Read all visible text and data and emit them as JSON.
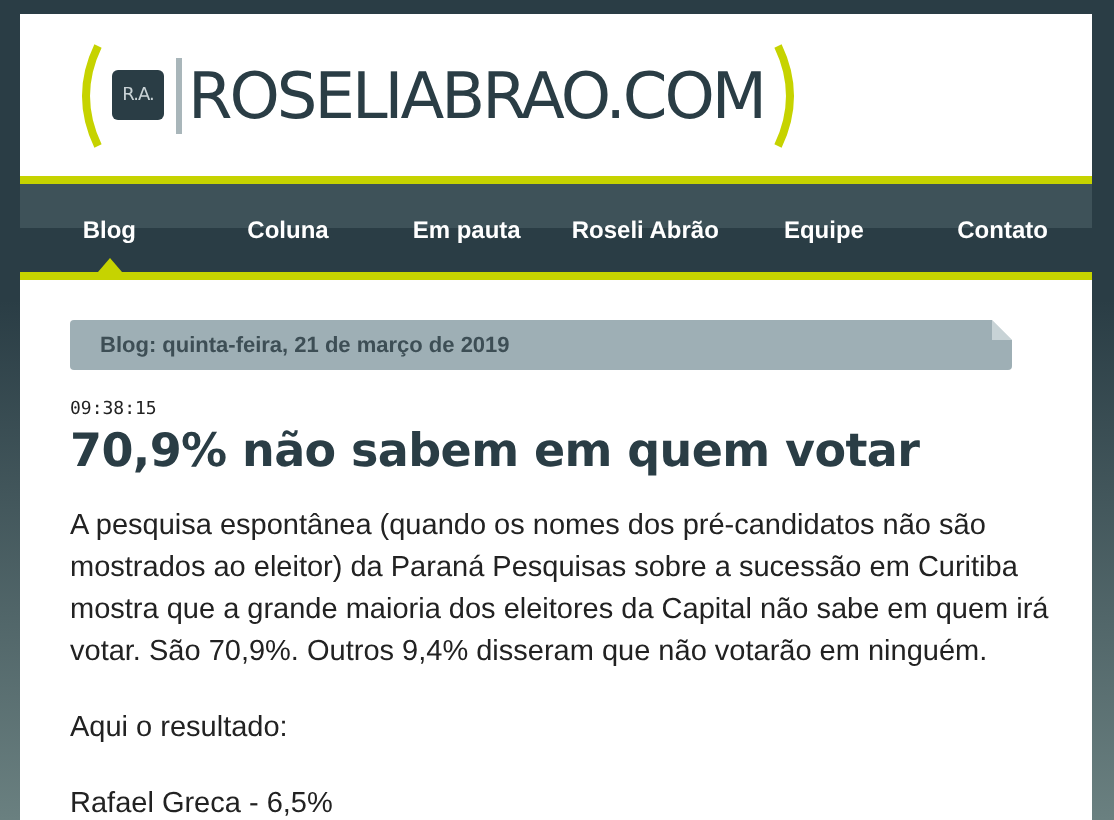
{
  "logo": {
    "badge": "R.A.",
    "title": "ROSELIABRAO.COM"
  },
  "nav": [
    {
      "label": "Blog",
      "selected": true
    },
    {
      "label": "Coluna",
      "selected": false
    },
    {
      "label": "Em pauta",
      "selected": false
    },
    {
      "label": "Roseli Abrão",
      "selected": false
    },
    {
      "label": "Equipe",
      "selected": false
    },
    {
      "label": "Contato",
      "selected": false
    }
  ],
  "date_bar": "Blog: quinta-feira, 21 de março de 2019",
  "post": {
    "time": "09:38:15",
    "title": "70,9% não sabem em quem votar",
    "paragraphs": [
      "A pesquisa espontânea (quando os nomes dos pré-candidatos não são mostrados ao eleitor) da Paraná Pesquisas sobre a sucessão em Curitiba mostra que a grande maioria dos eleitores da Capital não sabe em quem irá votar. São 70,9%. Outros 9,4% disseram que não votarão em ninguém.",
      "Aqui o resultado:",
      "Rafael Greca - 6,5%"
    ]
  }
}
